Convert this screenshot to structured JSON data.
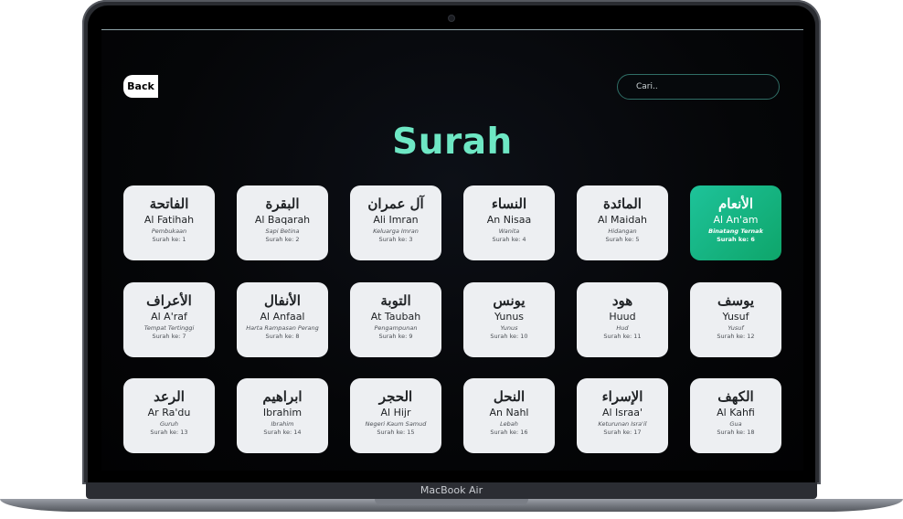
{
  "header": {
    "back_label": "Back",
    "search_placeholder": "Cari..",
    "title": "Surah"
  },
  "device": {
    "label": "MacBook Air"
  },
  "colors": {
    "accent": "#6ee7c4",
    "active_card": "#12b582",
    "card": "#edeff2"
  },
  "surahs": [
    {
      "arabic": "الفاتحة",
      "latin": "Al Fatihah",
      "meaning": "Pembukaan",
      "number": "Surah ke: 1",
      "active": false
    },
    {
      "arabic": "البقرة",
      "latin": "Al Baqarah",
      "meaning": "Sapi Betina",
      "number": "Surah ke: 2",
      "active": false
    },
    {
      "arabic": "آل عمران",
      "latin": "Ali Imran",
      "meaning": "Keluarga Imran",
      "number": "Surah ke: 3",
      "active": false
    },
    {
      "arabic": "النساء",
      "latin": "An Nisaa",
      "meaning": "Wanita",
      "number": "Surah ke: 4",
      "active": false
    },
    {
      "arabic": "المائدة",
      "latin": "Al Maidah",
      "meaning": "Hidangan",
      "number": "Surah ke: 5",
      "active": false
    },
    {
      "arabic": "الأنعام",
      "latin": "Al An'am",
      "meaning": "Binatang Ternak",
      "number": "Surah ke: 6",
      "active": true
    },
    {
      "arabic": "الأعراف",
      "latin": "Al A'raf",
      "meaning": "Tempat Tertinggi",
      "number": "Surah ke: 7",
      "active": false
    },
    {
      "arabic": "الأنفال",
      "latin": "Al Anfaal",
      "meaning": "Harta Rampasan Perang",
      "number": "Surah ke: 8",
      "active": false
    },
    {
      "arabic": "التوبة",
      "latin": "At Taubah",
      "meaning": "Pengampunan",
      "number": "Surah ke: 9",
      "active": false
    },
    {
      "arabic": "يونس",
      "latin": "Yunus",
      "meaning": "Yunus",
      "number": "Surah ke: 10",
      "active": false
    },
    {
      "arabic": "هود",
      "latin": "Huud",
      "meaning": "Hud",
      "number": "Surah ke: 11",
      "active": false
    },
    {
      "arabic": "يوسف",
      "latin": "Yusuf",
      "meaning": "Yusuf",
      "number": "Surah ke: 12",
      "active": false
    },
    {
      "arabic": "الرعد",
      "latin": "Ar Ra'du",
      "meaning": "Guruh",
      "number": "Surah ke: 13",
      "active": false
    },
    {
      "arabic": "ابراهيم",
      "latin": "Ibrahim",
      "meaning": "Ibrahim",
      "number": "Surah ke: 14",
      "active": false
    },
    {
      "arabic": "الحجر",
      "latin": "Al Hijr",
      "meaning": "Negeri Kaum Samud",
      "number": "Surah ke: 15",
      "active": false
    },
    {
      "arabic": "النحل",
      "latin": "An Nahl",
      "meaning": "Lebah",
      "number": "Surah ke: 16",
      "active": false
    },
    {
      "arabic": "الإسراء",
      "latin": "Al Israa'",
      "meaning": "Keturunan Isra'il",
      "number": "Surah ke: 17",
      "active": false
    },
    {
      "arabic": "الكهف",
      "latin": "Al Kahfi",
      "meaning": "Gua",
      "number": "Surah ke: 18",
      "active": false
    }
  ]
}
